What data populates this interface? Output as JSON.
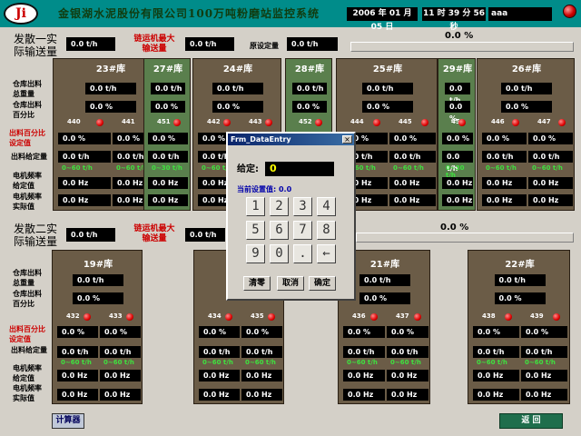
{
  "header": {
    "logo_text": "Ji",
    "title": "金银湖水泥股份有限公司100万吨粉磨站监控系统",
    "date": "2006 年 01 月 05 日",
    "time": "11 时 39 分 56 秒",
    "user": "aaa"
  },
  "line1": {
    "label": "发散一实际输送量",
    "actual_value": "0.0 t/h",
    "chain_label": "链运机最大输送量",
    "chain_value": "0.0 t/h",
    "set_label": "原设定量",
    "set_value": "0.0 t/h",
    "percent": "0.0 %"
  },
  "line2": {
    "label": "发散二实际输送量",
    "actual_value": "0.0 t/h",
    "chain_label": "链运机最大输送量",
    "chain_value": "0.0 t/h",
    "percent": "0.0 %"
  },
  "row_labels": {
    "weight": "仓库出料总重量",
    "percent": "仓库出料百分比",
    "pct_set": "出料百分比设定值",
    "out_set": "出料给定量",
    "freq_set": "电机频率给定值",
    "freq_actual": "电机频率实际值"
  },
  "tanks_top": [
    {
      "name": "23#库",
      "weight": "0.0 t/h",
      "pct": "0.0 %",
      "ids": [
        "440",
        "441"
      ],
      "pset": [
        "0.0 %",
        "0.0 %"
      ],
      "out": [
        "0.0 t/h",
        "0.0 t/h"
      ],
      "range": [
        "0~60 t/h",
        "0~60 t/h"
      ],
      "fset": [
        "0.0 Hz",
        "0.0 Hz"
      ],
      "fact": [
        "0.0 Hz",
        "0.0 Hz"
      ]
    },
    {
      "name": "27#库",
      "weight": "0.0 t/h",
      "pct": "0.0 %",
      "ids": [
        "451"
      ],
      "pset": [
        "0.0 %"
      ],
      "out": [
        "0.0 t/h"
      ],
      "range": [
        "0~30 t/h"
      ],
      "fset": [
        "0.0 Hz"
      ],
      "fact": [
        "0.0 Hz"
      ]
    },
    {
      "name": "24#库",
      "weight": "0.0 t/h",
      "pct": "0.0 %",
      "ids": [
        "442",
        "443"
      ],
      "pset": [
        "0.0 %",
        "0.0 %"
      ],
      "out": [
        "0.0 t/h",
        "0.0 t/h"
      ],
      "range": [
        "0~60 t/h",
        "0~60 t/h"
      ],
      "fset": [
        "0.0 Hz",
        "0.0 Hz"
      ],
      "fact": [
        "0.0 Hz",
        "0.0 Hz"
      ]
    },
    {
      "name": "28#库",
      "weight": "0.0 t/h",
      "pct": "0.0 %",
      "ids": [
        "452"
      ],
      "pset": [
        "0.0 %"
      ],
      "out": [
        "0.0 t/h"
      ],
      "range": [
        "0~30 t/h"
      ],
      "fset": [
        "0.0 Hz"
      ],
      "fact": [
        "0.0 Hz"
      ]
    },
    {
      "name": "25#库",
      "weight": "0.0 t/h",
      "pct": "0.0 %",
      "ids": [
        "444",
        "445"
      ],
      "pset": [
        "0.0 %",
        "0.0 %"
      ],
      "out": [
        "0.0 t/h",
        "0.0 t/h"
      ],
      "range": [
        "0~60 t/h",
        "0~60 t/h"
      ],
      "fset": [
        "0.0 Hz",
        "0.0 Hz"
      ],
      "fact": [
        "0.0 Hz",
        "0.0 Hz"
      ]
    },
    {
      "name": "29#库",
      "weight": "0.0 t/h",
      "pct": "0.0 %",
      "ids": [
        "453"
      ],
      "pset": [
        "0.0 %"
      ],
      "out": [
        "0.0 t/h"
      ],
      "range": [
        "0~30 t/h"
      ],
      "fset": [
        "0.0 Hz"
      ],
      "fact": [
        "0.0 Hz"
      ]
    },
    {
      "name": "26#库",
      "weight": "0.0 t/h",
      "pct": "0.0 %",
      "ids": [
        "446",
        "447"
      ],
      "pset": [
        "0.0 %",
        "0.0 %"
      ],
      "out": [
        "0.0 t/h",
        "0.0 t/h"
      ],
      "range": [
        "0~60 t/h",
        "0~60 t/h"
      ],
      "fset": [
        "0.0 Hz",
        "0.0 Hz"
      ],
      "fact": [
        "0.0 Hz",
        "0.0 Hz"
      ]
    }
  ],
  "tanks_bottom": [
    {
      "name": "19#库",
      "weight": "0.0 t/h",
      "pct": "0.0 %",
      "ids": [
        "432",
        "433"
      ],
      "pset": [
        "0.0 %",
        "0.0 %"
      ],
      "out": [
        "0.0 t/h",
        "0.0 t/h"
      ],
      "range": [
        "0~60 t/h",
        "0~60 t/h"
      ],
      "fset": [
        "0.0 Hz",
        "0.0 Hz"
      ],
      "fact": [
        "0.0 Hz",
        "0.0 Hz"
      ]
    },
    {
      "name": "",
      "weight": "",
      "pct": "",
      "ids": [
        "434",
        "435"
      ],
      "pset": [
        "0.0 %",
        "0.0 %"
      ],
      "out": [
        "0.0 t/h",
        "0.0 t/h"
      ],
      "range": [
        "0~60 t/h",
        "0~60 t/h"
      ],
      "fset": [
        "0.0 Hz",
        "0.0 Hz"
      ],
      "fact": [
        "0.0 Hz",
        "0.0 Hz"
      ]
    },
    {
      "name": "21#库",
      "weight": "0.0 t/h",
      "pct": "0.0 %",
      "ids": [
        "436",
        "437"
      ],
      "pset": [
        "0.0 %",
        "0.0 %"
      ],
      "out": [
        "0.0 t/h",
        "0.0 t/h"
      ],
      "range": [
        "0~60 t/h",
        "0~60 t/h"
      ],
      "fset": [
        "0.0 Hz",
        "0.0 Hz"
      ],
      "fact": [
        "0.0 Hz",
        "0.0 Hz"
      ]
    },
    {
      "name": "22#库",
      "weight": "0.0 t/h",
      "pct": "0.0 %",
      "ids": [
        "438",
        "439"
      ],
      "pset": [
        "0.0 %",
        "0.0 %"
      ],
      "out": [
        "0.0 t/h",
        "0.0 t/h"
      ],
      "range": [
        "0~60 t/h",
        "0~60 t/h"
      ],
      "fset": [
        "0.0 Hz",
        "0.0 Hz"
      ],
      "fact": [
        "0.0 Hz",
        "0.0 Hz"
      ]
    }
  ],
  "dialog": {
    "title": "Frm_DataEntry",
    "close": "×",
    "given_label": "给定:",
    "given_value": "0",
    "current_label": "当前设置值: 0.0",
    "keys": [
      "1",
      "2",
      "3",
      "4",
      "5",
      "6",
      "7",
      "8",
      "9",
      "0",
      ".",
      "←"
    ],
    "clear": "清零",
    "cancel": "取消",
    "ok": "确定"
  },
  "footer": {
    "calculator": "计算器",
    "back": "返 回"
  }
}
